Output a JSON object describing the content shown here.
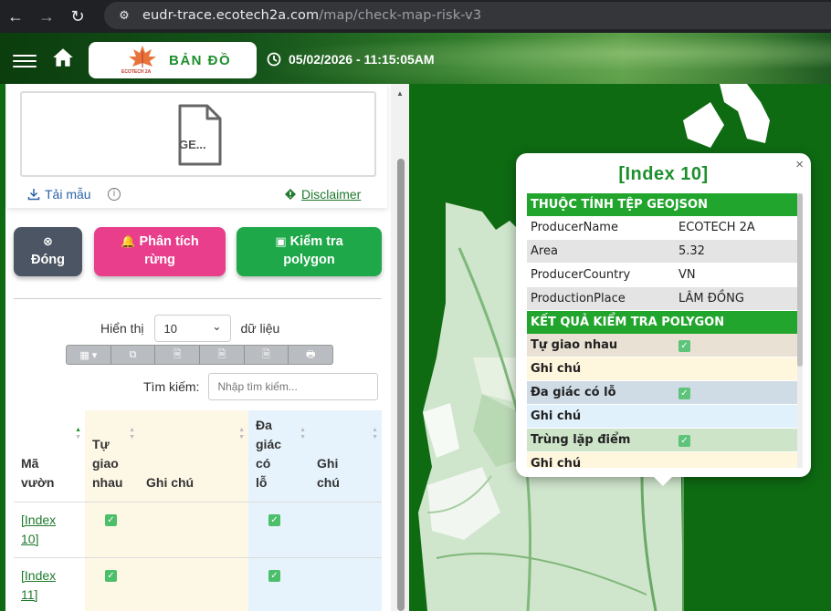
{
  "browser": {
    "url_host": "eudr-trace.ecotech2a.com",
    "url_path": "/map/check-map-risk-v3"
  },
  "header": {
    "brand_logo_text": "ECOTECH 2A",
    "brand_title": "BẢN ĐỒ",
    "datetime": "05/02/2026 - 11:15:05AM"
  },
  "upload": {
    "file_label": "GE...",
    "sample_link": "Tải mẫu",
    "disclaimer": "Disclaimer"
  },
  "buttons": {
    "close": "Đóng",
    "forest_line1": "Phân tích",
    "forest_line2": "rừng",
    "check_line1": "Kiểm tra",
    "check_line2": "polygon"
  },
  "table_controls": {
    "show_label": "Hiển thị",
    "page_size": "10",
    "records_label": "dữ liệu",
    "search_label": "Tìm kiếm:",
    "search_placeholder": "Nhập tìm kiếm..."
  },
  "table": {
    "headers": {
      "garden": [
        "Mã",
        "vườn"
      ],
      "intersect": [
        "Tự",
        "giao",
        "nhau"
      ],
      "note1": [
        "Ghi chú"
      ],
      "hole": [
        "Đa",
        "giác",
        "có",
        "lỗ"
      ],
      "note2": [
        "Ghi",
        "chú"
      ]
    },
    "rows": [
      {
        "id_l1": "[Index",
        "id_l2": "10]"
      },
      {
        "id_l1": "[Index",
        "id_l2": "11]"
      }
    ]
  },
  "popup": {
    "title": "[Index 10]",
    "section_geojson": "THUỘC TÍNH TỆP GEOJSON",
    "props": [
      {
        "key": "ProducerName",
        "value": "ECOTECH 2A"
      },
      {
        "key": "Area",
        "value": "5.32"
      },
      {
        "key": "ProducerCountry",
        "value": "VN"
      },
      {
        "key": "ProductionPlace",
        "value": "LÂM ĐỒNG"
      }
    ],
    "section_result": "KẾT QUẢ KIỂM TRA POLYGON",
    "results": [
      {
        "key": "Tự giao nhau"
      },
      {
        "key": "Ghi chú"
      },
      {
        "key": "Đa giác có lỗ"
      },
      {
        "key": "Ghi chú"
      },
      {
        "key": "Trùng lặp điểm"
      },
      {
        "key": "Ghi chú"
      }
    ]
  },
  "colors": {
    "brand_green": "#1e8f2d",
    "map_forest": "#0e6b12",
    "close_button": "#4c5563",
    "forest_button": "#e83e8c",
    "check_button": "#1fa84a"
  }
}
